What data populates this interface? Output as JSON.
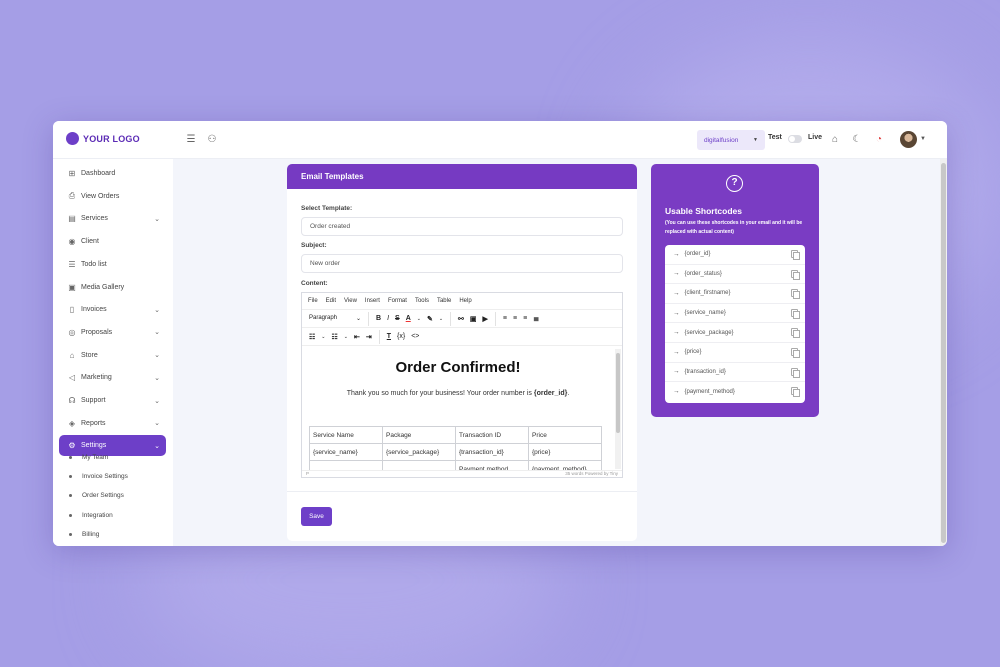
{
  "app": {
    "logo_text": "YOUR LOGO",
    "workspace": "digitalfusion",
    "mode_test": "Test",
    "mode_live": "Live"
  },
  "sidebar": {
    "items": [
      {
        "label": "Dashboard",
        "icon": "dashboard-icon",
        "glyph": "⊞",
        "chevron": false
      },
      {
        "label": "View Orders",
        "icon": "cart-icon",
        "glyph": "⎙",
        "chevron": false
      },
      {
        "label": "Services",
        "icon": "grid-icon",
        "glyph": "▤",
        "chevron": true
      },
      {
        "label": "Client",
        "icon": "user-icon",
        "glyph": "◉",
        "chevron": false
      },
      {
        "label": "Todo list",
        "icon": "list-icon",
        "glyph": "☰",
        "chevron": false
      },
      {
        "label": "Media Gallery",
        "icon": "image-icon",
        "glyph": "▣",
        "chevron": false
      },
      {
        "label": "Invoices",
        "icon": "file-icon",
        "glyph": "▯",
        "chevron": true
      },
      {
        "label": "Proposals",
        "icon": "proposal-icon",
        "glyph": "◎",
        "chevron": true
      },
      {
        "label": "Store",
        "icon": "store-icon",
        "glyph": "⌂",
        "chevron": true
      },
      {
        "label": "Marketing",
        "icon": "megaphone-icon",
        "glyph": "◁",
        "chevron": true
      },
      {
        "label": "Support",
        "icon": "support-icon",
        "glyph": "☊",
        "chevron": true
      },
      {
        "label": "Reports",
        "icon": "report-icon",
        "glyph": "◈",
        "chevron": true
      },
      {
        "label": "Settings",
        "icon": "gear-icon",
        "glyph": "⚙",
        "chevron": true,
        "active": true
      }
    ],
    "sub_items": [
      "My Team",
      "Invoice Settings",
      "Order Settings",
      "Integration",
      "Billing"
    ]
  },
  "email": {
    "header": "Email Templates",
    "template_label": "Select Template:",
    "template_value": "Order created",
    "subject_label": "Subject:",
    "subject_value": "New order",
    "content_label": "Content:",
    "menu": [
      "File",
      "Edit",
      "View",
      "Insert",
      "Format",
      "Tools",
      "Table",
      "Help"
    ],
    "paragraph": "Paragraph",
    "doc_title": "Order Confirmed!",
    "doc_text_prefix": "Thank you so much for your business! Your order number is ",
    "doc_text_bold": "{order_id}",
    "doc_text_suffix": ".",
    "table": [
      [
        "Service Name",
        "Package",
        "Transaction ID",
        "Price"
      ],
      [
        "{service_name}",
        "{service_package}",
        "{transaction_id}",
        "{price}"
      ],
      [
        "",
        "",
        "Payment method",
        "{payment_method}"
      ]
    ],
    "status_left": "P",
    "status_right": "35 words  Powered by Tiny",
    "save_label": "Save"
  },
  "shortcodes": {
    "title": "Usable Shortcodes",
    "note": "(You can use these shortcodes in your email and it will be replaced with actual content)",
    "items": [
      "{order_id}",
      "{order_status}",
      "{client_firstname}",
      "{service_name}",
      "{service_package}",
      "{price}",
      "{transaction_id}",
      "{payment_method}"
    ]
  },
  "colors": {
    "brand": "#6d3fc8",
    "panel": "#7a3cc3"
  }
}
